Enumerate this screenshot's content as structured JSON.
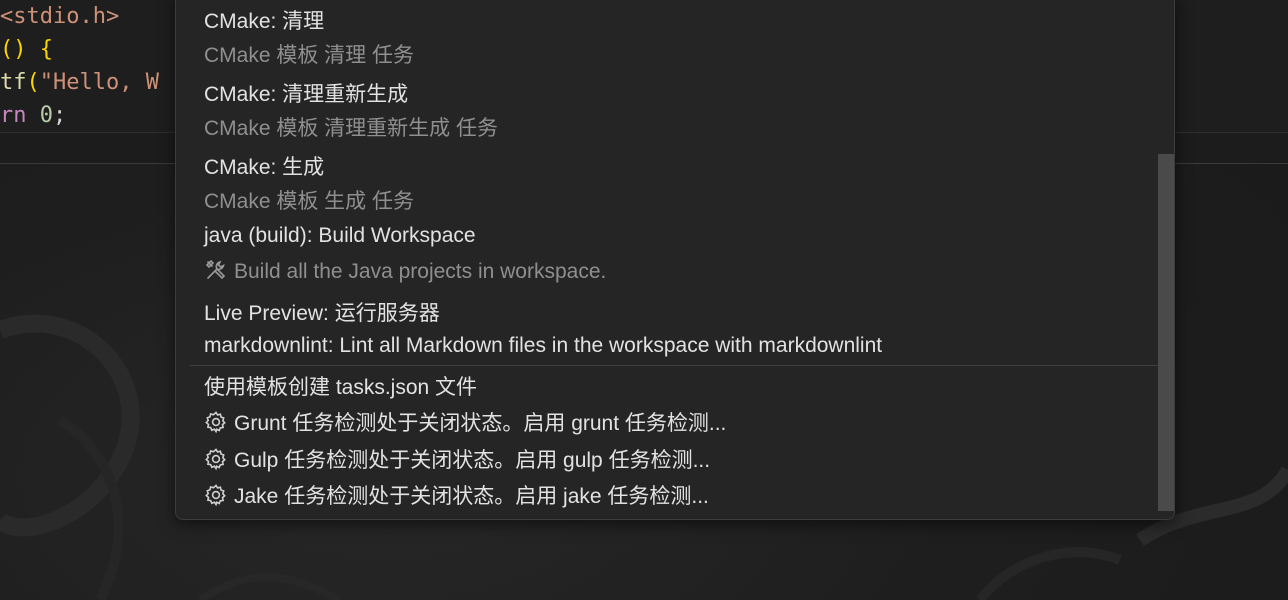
{
  "editor": {
    "lines": [
      {
        "parts": [
          {
            "t": "<stdio.h>",
            "c": "c-inc"
          }
        ]
      },
      {
        "parts": [
          {
            "t": "() {",
            "c": "c-br"
          }
        ]
      },
      {
        "parts": [
          {
            "t": "tf",
            "c": "c-fn"
          },
          {
            "t": "(",
            "c": "c-br"
          },
          {
            "t": "\"Hello, W",
            "c": "c-str"
          }
        ]
      },
      {
        "parts": [
          {
            "t": "rn ",
            "c": "c-kw"
          },
          {
            "t": "0",
            "c": "c-num"
          },
          {
            "t": ";",
            "c": "c-punc"
          }
        ]
      }
    ]
  },
  "quick_pick": {
    "items": [
      {
        "label": "CMake: 清理",
        "detail": "CMake 模板 清理 任务",
        "icon": ""
      },
      {
        "label": "CMake: 清理重新生成",
        "detail": "CMake 模板 清理重新生成 任务",
        "icon": ""
      },
      {
        "label": "CMake: 生成",
        "detail": "CMake 模板 生成 任务",
        "icon": ""
      },
      {
        "label": "java (build): Build Workspace",
        "detail": "Build all the Java projects in workspace.",
        "detail_icon": "tools-icon"
      },
      {
        "label": "Live Preview: 运行服务器",
        "detail": "",
        "icon": ""
      },
      {
        "label": "markdownlint: Lint all Markdown files in the workspace with markdownlint",
        "detail": "",
        "icon": ""
      }
    ],
    "extra_items": [
      {
        "label": "使用模板创建 tasks.json 文件",
        "icon": ""
      },
      {
        "label": "Grunt 任务检测处于关闭状态。启用 grunt 任务检测...",
        "icon": "gear-icon"
      },
      {
        "label": "Gulp 任务检测处于关闭状态。启用 gulp 任务检测...",
        "icon": "gear-icon"
      },
      {
        "label": "Jake 任务检测处于关闭状态。启用 jake 任务检测...",
        "icon": "gear-icon"
      }
    ]
  },
  "colors": {
    "palette_bg": "#252526",
    "label": "#e2e2e2",
    "detail": "#8f8f8f",
    "scroll_thumb": "#4a4a4a"
  }
}
